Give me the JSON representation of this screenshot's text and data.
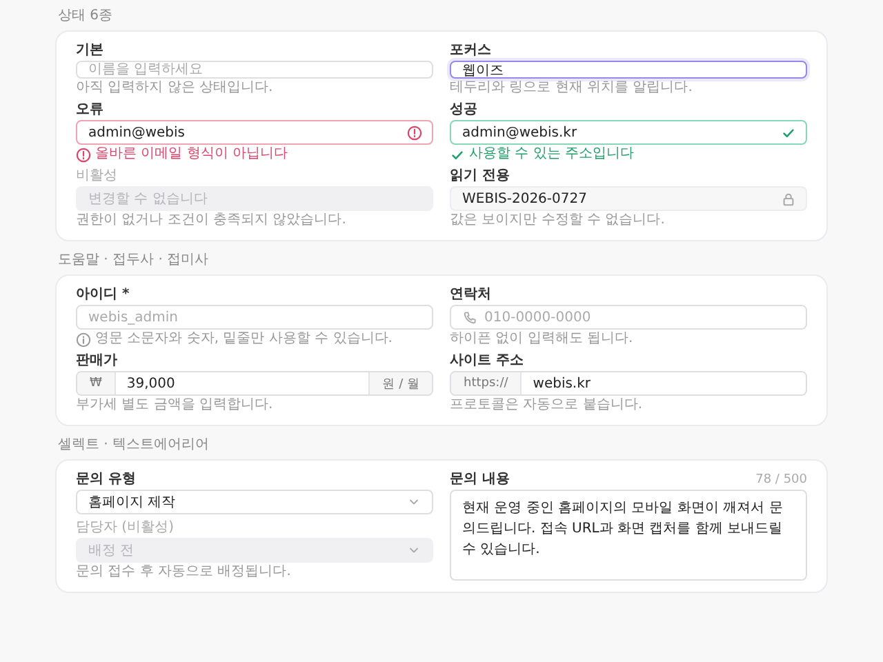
{
  "sections": [
    {
      "title": "상태 6종",
      "fields": [
        {
          "label": "기본",
          "kind": "text",
          "placeholder": "이름을 입력하세요",
          "help": "아직 입력하지 않은 상태입니다."
        },
        {
          "label": "포커스",
          "kind": "text",
          "focused": true,
          "value": "웹이즈",
          "help": "테두리와 링으로 현재 위치를 알립니다."
        },
        {
          "label": "오류",
          "kind": "text",
          "invalid": true,
          "value": "admin@webis",
          "help": "올바른 이메일 형식이 아닙니다",
          "help_icon": true
        },
        {
          "label": "성공",
          "kind": "text",
          "valid": true,
          "value": "admin@webis.kr",
          "help": "사용할 수 있는 주소입니다",
          "help_icon": true
        },
        {
          "label": "비활성",
          "kind": "text",
          "disabled": true,
          "placeholder": "변경할 수 없습니다",
          "help": "권한이 없거나 조건이 충족되지 않았습니다."
        },
        {
          "label": "읽기 전용",
          "kind": "text",
          "readonly": true,
          "value": "WEBIS-2026-0727",
          "help": "값은 보이지만 수정할 수 없습니다."
        }
      ]
    },
    {
      "title": "도움말 · 접두사 · 접미사",
      "fields": [
        {
          "label": "아이디 *",
          "kind": "text",
          "placeholder": "webis_admin",
          "help": "영문 소문자와 숫자, 밑줄만 사용할 수 있습니다.",
          "help_icon": true
        },
        {
          "label": "연락처",
          "kind": "phone",
          "placeholder": "010-0000-0000",
          "help": "하이픈 없이 입력해도 됩니다."
        },
        {
          "label": "판매가",
          "kind": "text",
          "prefix": "₩",
          "value": "39,000",
          "suffix": "원 / 월",
          "help": "부가세 별도 금액을 입력합니다."
        },
        {
          "label": "사이트 주소",
          "kind": "text",
          "prefix": "https://",
          "value": "webis.kr",
          "help": "프로토콜은 자동으로 붙습니다."
        }
      ]
    },
    {
      "title": "셀렉트 · 텍스트에어리어",
      "fields": [
        {
          "label": "문의 유형",
          "kind": "select",
          "value": "홈페이지 제작"
        },
        {
          "label": "문의 내용",
          "kind": "textarea",
          "counter": "78 / 500",
          "value": "현재 운영 중인 홈페이지의 모바일 화면이 깨져서 문의드립니다. 접속 URL과 화면 캡처를 함께 보내드릴 수 있습니다."
        },
        {
          "label": "담당자 (비활성)",
          "kind": "select",
          "disabled": true,
          "placeholder": "배정 전",
          "help": "문의 접수 후 자동으로 배정됩니다."
        }
      ]
    }
  ]
}
